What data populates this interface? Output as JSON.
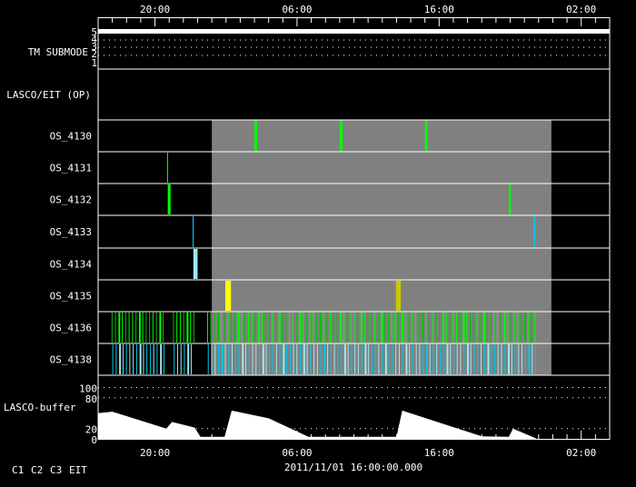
{
  "chart_data": {
    "type": "timeline",
    "x_range_hours": [
      0,
      36
    ],
    "x_origin_label": "16:00",
    "x_ticks": [
      {
        "h": 4,
        "label": "20:00"
      },
      {
        "h": 14,
        "label": "06:00"
      },
      {
        "h": 24,
        "label": "16:00"
      },
      {
        "h": 34,
        "label": "02:00"
      }
    ],
    "center_time": "2011/11/01 16:00:00.000",
    "tm_submode": {
      "label": "TM SUBMODE",
      "levels": [
        "5",
        "4",
        "3",
        "2",
        "1"
      ],
      "value": 5
    },
    "lasco_eit_op": {
      "label": "LASCO/EIT (OP)"
    },
    "gray_period_hours": [
      8.0,
      31.9
    ],
    "rows": [
      {
        "label": "OS_4130",
        "events": [
          {
            "h": 11.0,
            "w": 0.2,
            "color": "#00ff00"
          },
          {
            "h": 17.0,
            "w": 0.2,
            "color": "#00ff00"
          },
          {
            "h": 23.0,
            "w": 0.2,
            "color": "#00ff00"
          }
        ]
      },
      {
        "label": "OS_4131",
        "events": [
          {
            "h": 4.85,
            "w": 0.07,
            "color": "#00ff00"
          },
          {
            "h": 28.75,
            "w": 0.07,
            "color": "#00ff00",
            "short": true
          }
        ]
      },
      {
        "label": "OS_4132",
        "events": [
          {
            "h": 4.9,
            "w": 0.2,
            "color": "#00ff00"
          },
          {
            "h": 28.9,
            "w": 0.15,
            "color": "#00ff00"
          }
        ]
      },
      {
        "label": "OS_4133",
        "events": [
          {
            "h": 6.65,
            "w": 0.07,
            "color": "#00c8f0"
          },
          {
            "h": 30.65,
            "w": 0.12,
            "color": "#00c8f0"
          }
        ]
      },
      {
        "label": "OS_4134",
        "events": [
          {
            "h": 6.7,
            "w": 0.3,
            "color": "#a0e8f0"
          }
        ]
      },
      {
        "label": "OS_4135",
        "events": [
          {
            "h": 8.95,
            "w": 0.4,
            "color": "#ffff00"
          },
          {
            "h": 20.95,
            "w": 0.35,
            "color": "#c8c800"
          }
        ]
      },
      {
        "label": "OS_4136",
        "series": {
          "start_h": 0.95,
          "end_h": 30.8,
          "step_h": 0.24,
          "gaps": [
            [
              4.7,
              5.1
            ],
            [
              6.75,
              7.6
            ]
          ],
          "colors": [
            "#00ff00",
            "#00c000"
          ]
        }
      },
      {
        "label": "OS_4138",
        "series": {
          "start_h": 1.0,
          "end_h": 30.8,
          "step_h": 0.24,
          "gaps": [
            [
              4.7,
              5.1
            ],
            [
              6.75,
              7.6
            ]
          ],
          "colors": [
            "#a0e8f0",
            "#00c8e8"
          ]
        }
      }
    ],
    "buffer": {
      "label": "LASCO-buffer",
      "y_ticks": [
        "100",
        "80",
        "20",
        "0"
      ],
      "ylim": [
        0,
        100
      ],
      "points": [
        [
          0,
          50
        ],
        [
          1,
          53
        ],
        [
          4.8,
          20
        ],
        [
          5.2,
          33
        ],
        [
          6.8,
          22
        ],
        [
          7.2,
          4
        ],
        [
          8.9,
          4
        ],
        [
          9.4,
          55
        ],
        [
          12,
          40
        ],
        [
          14.8,
          4
        ],
        [
          21,
          4
        ],
        [
          21.4,
          55
        ],
        [
          27,
          5
        ],
        [
          28.9,
          4
        ],
        [
          29.2,
          20
        ],
        [
          30.8,
          1
        ]
      ],
      "no_data_color": "#e00000"
    },
    "legend": [
      {
        "label": "C1",
        "color": "#ff0000"
      },
      {
        "label": "C2",
        "color": "#00ff00"
      },
      {
        "label": "C3",
        "color": "#a0e8f0"
      },
      {
        "label": "EIT",
        "color": "#ffff00"
      }
    ]
  }
}
